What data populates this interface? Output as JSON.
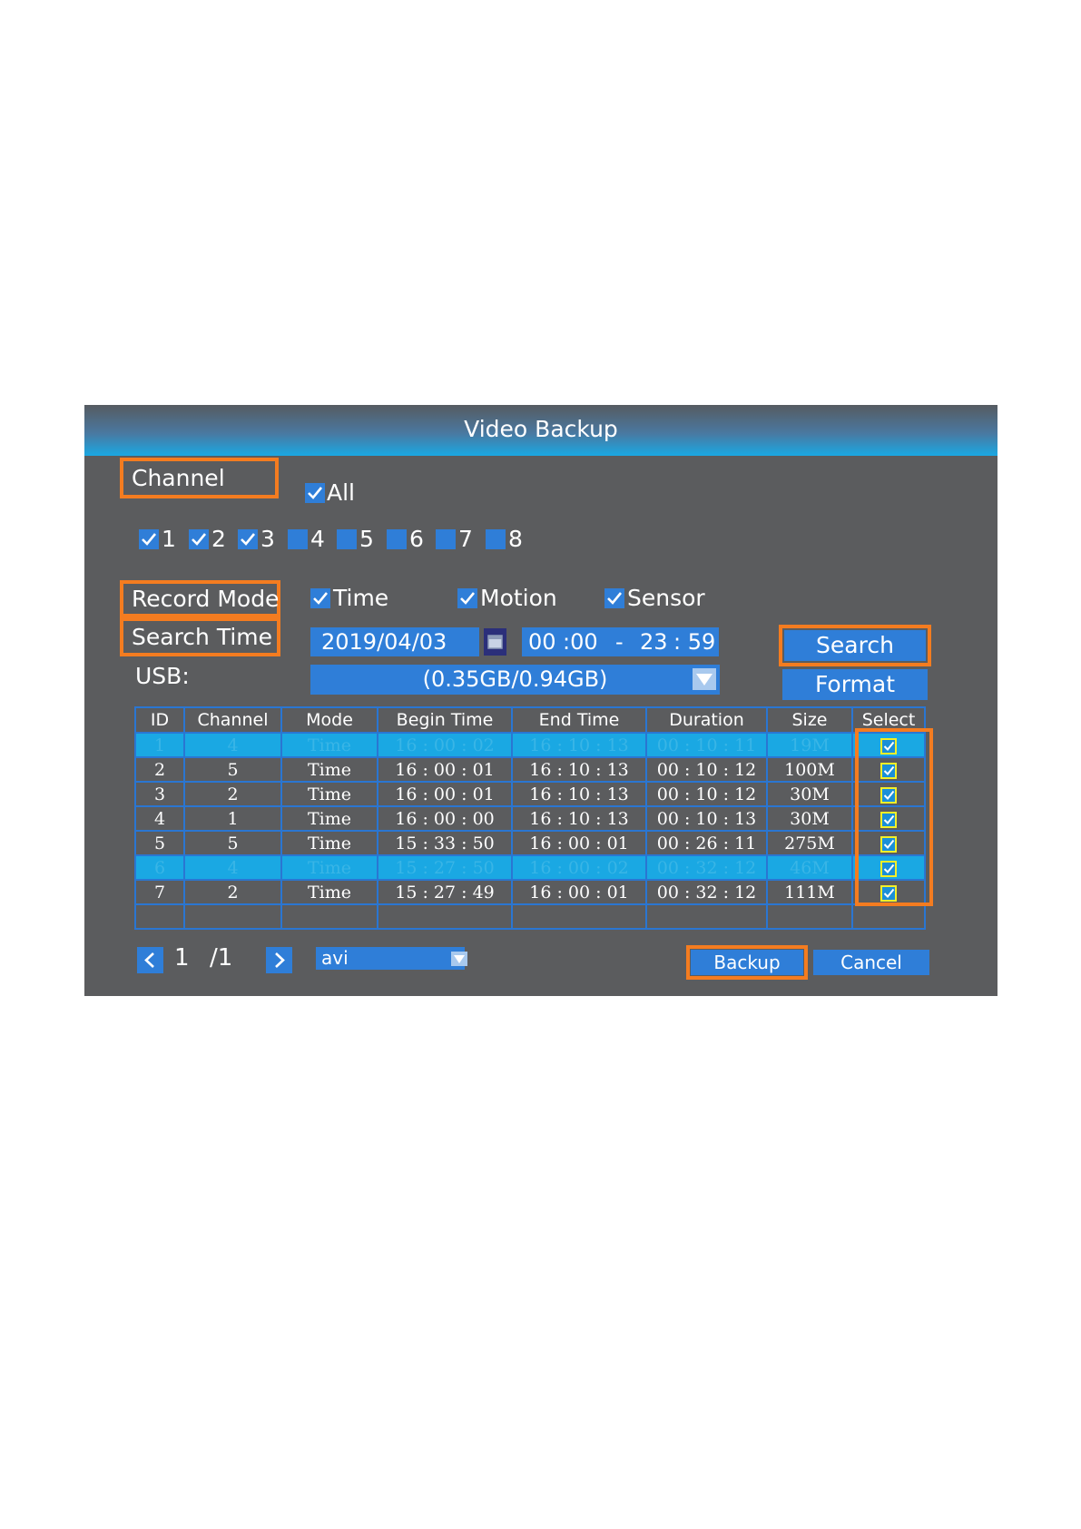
{
  "window": {
    "title": "Video Backup"
  },
  "channel": {
    "label": "Channel",
    "all_label": "All",
    "all_checked": true,
    "items": [
      {
        "label": "1",
        "checked": true
      },
      {
        "label": "2",
        "checked": true
      },
      {
        "label": "3",
        "checked": true
      },
      {
        "label": "4",
        "checked": false
      },
      {
        "label": "5",
        "checked": false
      },
      {
        "label": "6",
        "checked": false
      },
      {
        "label": "7",
        "checked": false
      },
      {
        "label": "8",
        "checked": false
      }
    ]
  },
  "record_mode": {
    "label": "Record Mode",
    "options": [
      {
        "label": "Time",
        "checked": true
      },
      {
        "label": "Motion",
        "checked": true
      },
      {
        "label": "Sensor",
        "checked": true
      }
    ]
  },
  "search_time": {
    "label": "Search Time",
    "date": "2019/04/03",
    "start_h": "00",
    "start_m": ":00",
    "dash": "-",
    "end_h": "23",
    "end_m": ": 59"
  },
  "usb": {
    "label": "USB:",
    "value": "(0.35GB/0.94GB)"
  },
  "buttons": {
    "search": "Search",
    "format": "Format",
    "backup": "Backup",
    "cancel": "Cancel"
  },
  "table": {
    "headers": [
      "ID",
      "Channel",
      "Mode",
      "Begin Time",
      "End Time",
      "Duration",
      "Size",
      "Select"
    ],
    "rows": [
      {
        "id": "1",
        "channel": "4",
        "mode": "Time",
        "begin": "16 : 00 : 02",
        "end": "16 : 10 : 13",
        "duration": "00 : 10 : 11",
        "size": "19M",
        "selected": true,
        "highlighted": true
      },
      {
        "id": "2",
        "channel": "5",
        "mode": "Time",
        "begin": "16 : 00 : 01",
        "end": "16 : 10 : 13",
        "duration": "00 : 10 : 12",
        "size": "100M",
        "selected": true,
        "highlighted": false
      },
      {
        "id": "3",
        "channel": "2",
        "mode": "Time",
        "begin": "16 : 00 : 01",
        "end": "16 : 10 : 13",
        "duration": "00 : 10 : 12",
        "size": "30M",
        "selected": true,
        "highlighted": false
      },
      {
        "id": "4",
        "channel": "1",
        "mode": "Time",
        "begin": "16 : 00 : 00",
        "end": "16 : 10 : 13",
        "duration": "00 : 10 : 13",
        "size": "30M",
        "selected": true,
        "highlighted": false
      },
      {
        "id": "5",
        "channel": "5",
        "mode": "Time",
        "begin": "15 : 33 : 50",
        "end": "16 : 00 : 01",
        "duration": "00 : 26 : 11",
        "size": "275M",
        "selected": true,
        "highlighted": false
      },
      {
        "id": "6",
        "channel": "4",
        "mode": "Time",
        "begin": "15 : 27 : 50",
        "end": "16 : 00 : 02",
        "duration": "00 : 32 : 12",
        "size": "46M",
        "selected": true,
        "highlighted": true
      },
      {
        "id": "7",
        "channel": "2",
        "mode": "Time",
        "begin": "15 : 27 : 49",
        "end": "16 : 00 : 01",
        "duration": "00 : 32 : 12",
        "size": "111M",
        "selected": true,
        "highlighted": false
      }
    ]
  },
  "pagination": {
    "current": "1",
    "total": "/1"
  },
  "format_select": {
    "value": "avi"
  },
  "colors": {
    "panel": "#5b5c5e",
    "accent_blue": "#2f7ed8",
    "highlight_row": "#1aa8e3",
    "callout_orange": "#f47c20",
    "select_box": "#f3ef27"
  }
}
